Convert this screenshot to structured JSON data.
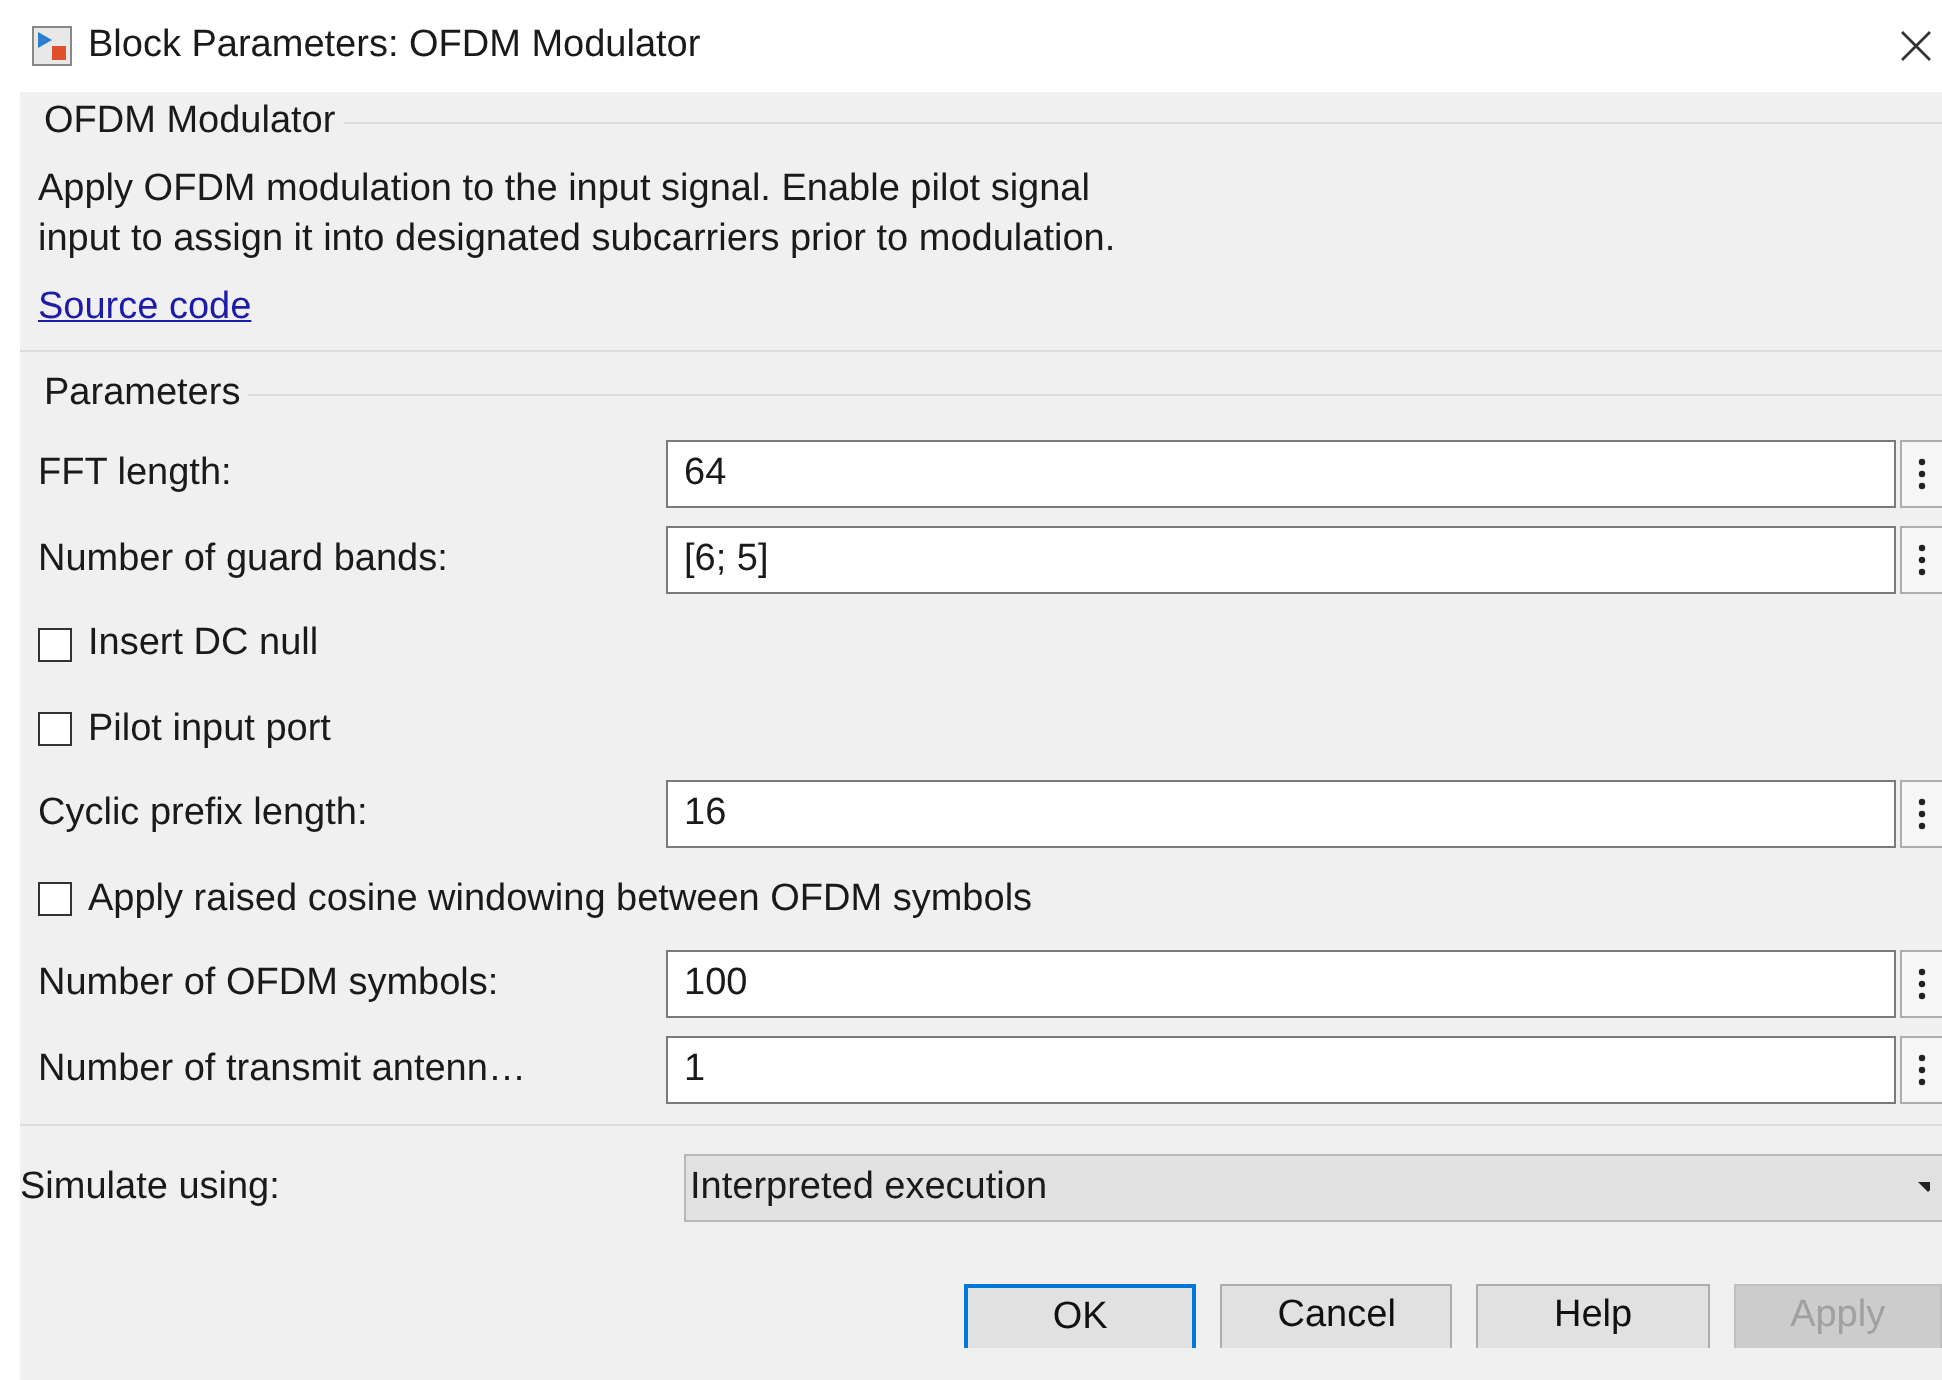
{
  "window": {
    "title": "Block Parameters: OFDM Modulator"
  },
  "description_group": {
    "title": "OFDM Modulator",
    "lines": [
      "Apply OFDM modulation to the input signal. Enable pilot signal",
      "input to assign it into designated subcarriers prior to modulation."
    ],
    "link": "Source code"
  },
  "parameters": {
    "title": "Parameters",
    "rows": [
      {
        "kind": "edit",
        "label": "FFT length:",
        "value": "64"
      },
      {
        "kind": "edit",
        "label": "Number of guard bands:",
        "value": "[6; 5]"
      },
      {
        "kind": "checkbox",
        "label": "Insert DC null",
        "checked": false
      },
      {
        "kind": "checkbox",
        "label": "Pilot input port",
        "checked": false
      },
      {
        "kind": "edit",
        "label": "Cyclic prefix length:",
        "value": "16"
      },
      {
        "kind": "checkbox",
        "label": "Apply raised cosine windowing between OFDM symbols",
        "checked": false
      },
      {
        "kind": "edit",
        "label": "Number of OFDM symbols:",
        "value": "100"
      },
      {
        "kind": "edit",
        "label": "Number of transmit antenn…",
        "value": "1"
      }
    ]
  },
  "simulate": {
    "label": "Simulate using:",
    "value": "Interpreted execution"
  },
  "buttons": [
    {
      "label": "OK",
      "default": true,
      "disabled": false
    },
    {
      "label": "Cancel",
      "default": false,
      "disabled": false
    },
    {
      "label": "Help",
      "default": false,
      "disabled": false
    },
    {
      "label": "Apply",
      "default": false,
      "disabled": true
    }
  ]
}
